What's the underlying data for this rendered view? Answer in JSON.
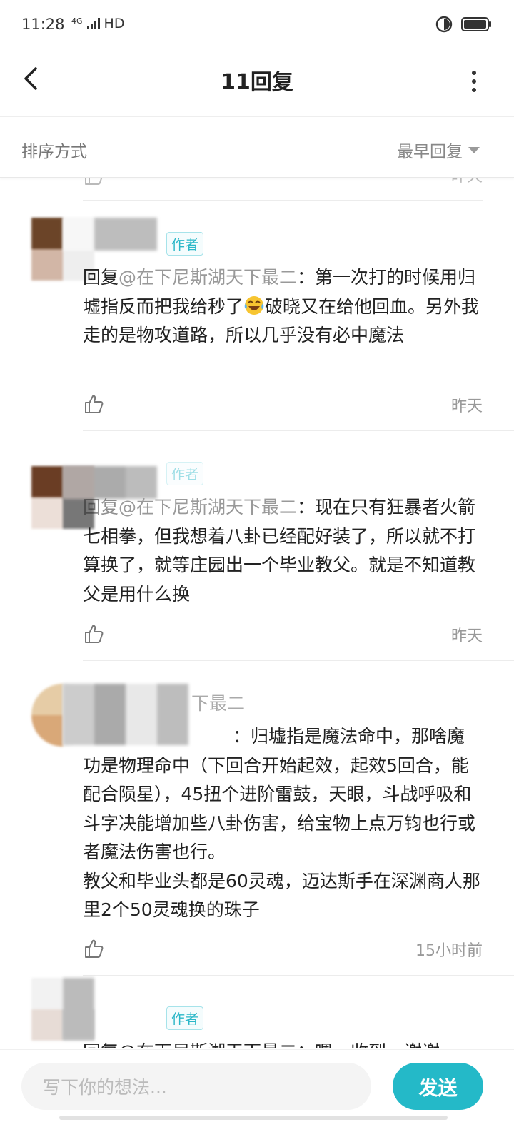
{
  "status_bar": {
    "time": "11:28",
    "network": "4G",
    "hd": "HD"
  },
  "header": {
    "title": "11回复",
    "back_icon": "chevron-left-icon",
    "more_icon": "more-vertical-icon"
  },
  "sort_bar": {
    "label": "排序方式",
    "selected": "最早回复"
  },
  "previous_item": {
    "time": "昨天"
  },
  "comments": [
    {
      "author_tag": "作者",
      "reply_prefix": "回复",
      "mention": "@在下尼斯湖天下最二",
      "text_a": "：第一次打的时候用归墟指反而把我给秒了",
      "emoji": "laughing-tears-emoji",
      "text_b": "破晓又在给他回血。另外我走的是物攻道路，所以几乎没有必中魔法",
      "time": "昨天"
    },
    {
      "author_tag": "作者",
      "reply_prefix": "回复",
      "mention": "@在下尼斯湖天下最二",
      "text": "：现在只有狂暴者火箭 七相拳，但我想着八卦已经配好装了，所以就不打算换了，就等庄园出一个毕业教父。就是不知道教父是用什么换",
      "time": "昨天"
    },
    {
      "username_tail": "下最二",
      "partial_a": "：归墟指是魔法命中，那啥魔",
      "partial_b": "功是物理命中（下回合开始起效，起效5回合，能配合陨星），45扭个进阶雷鼓，天眼，斗战呼吸和斗字决能增加些八卦伤害，给宝物上点万钧也行或者魔法伤害也行。",
      "text_2": "教父和毕业头都是60灵魂，迈达斯手在深渊商人那里2个50灵魂换的珠子",
      "time": "15小时前"
    },
    {
      "author_tag": "作者",
      "text": "回复@在下尼斯湖天下最二：嗯，收到，谢谢"
    }
  ],
  "bottom_bar": {
    "input_placeholder": "写下你的想法...",
    "send_label": "发送"
  },
  "colors": {
    "accent": "#24b9c8",
    "tag": "#2ab7c8",
    "muted_text": "#999999"
  }
}
